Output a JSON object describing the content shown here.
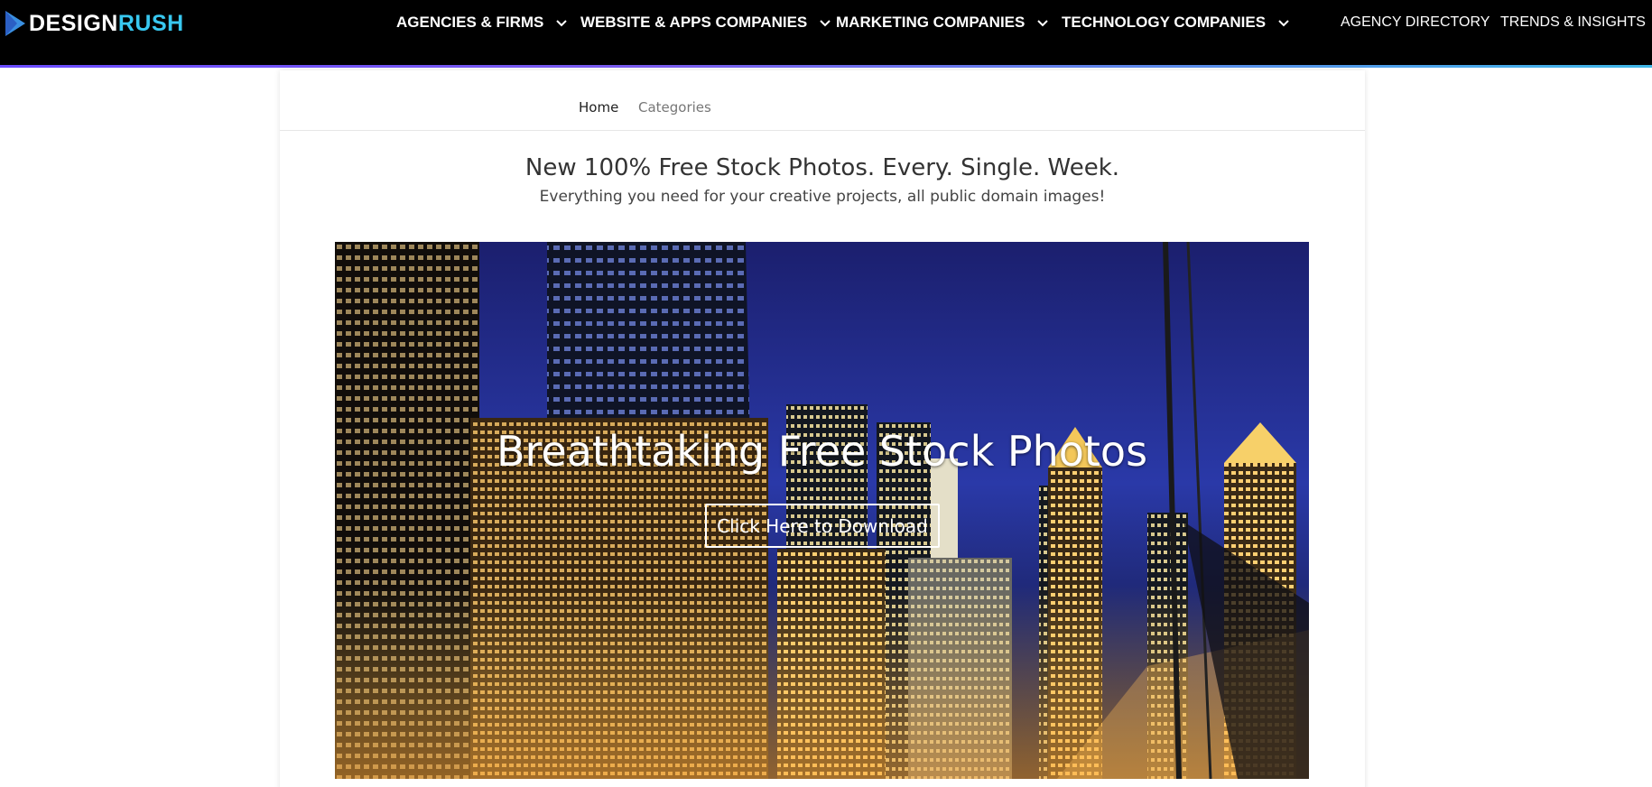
{
  "brand": {
    "part1": "DESIGN",
    "part2": "RUSH",
    "accent": "#38c8f0"
  },
  "nav": {
    "items": [
      {
        "label": "AGENCIES & FIRMS",
        "dropdown": true
      },
      {
        "label": "WEBSITE & APPS COMPANIES",
        "dropdown": true
      },
      {
        "label": "MARKETING COMPANIES",
        "dropdown": true
      },
      {
        "label": "TECHNOLOGY COMPANIES",
        "dropdown": true
      }
    ],
    "links": [
      {
        "label": "AGENCY DIRECTORY"
      },
      {
        "label": "TRENDS & INSIGHTS"
      }
    ]
  },
  "breadcrumb": {
    "home": "Home",
    "categories": "Categories"
  },
  "intro": {
    "headline": "New 100% Free Stock Photos. Every. Single. Week.",
    "subheadline": "Everything you need for your creative projects, all public domain images!"
  },
  "hero": {
    "title": "Breathtaking Free Stock Photos",
    "button": "Click Here to Download",
    "slide_count": 5,
    "active_slide": 1
  },
  "colors": {
    "nav_bg": "#000000",
    "accent_gradient_start": "#6a4cff",
    "accent_gradient_end": "#3fb8e8"
  }
}
